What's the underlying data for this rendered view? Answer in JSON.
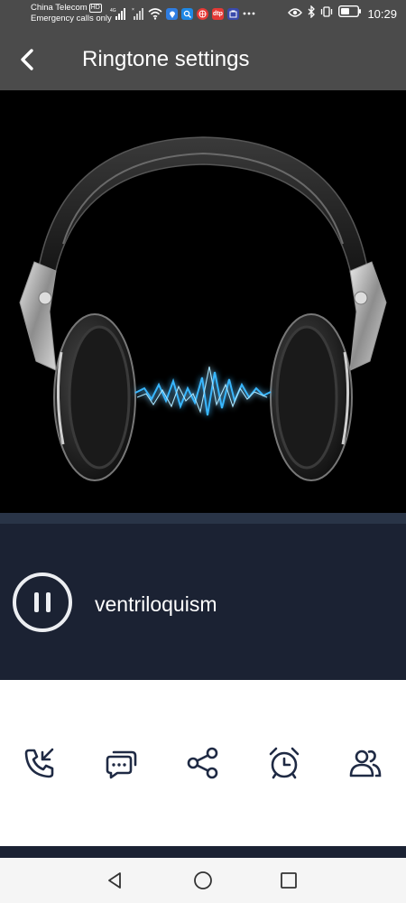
{
  "status_bar": {
    "carrier": "China Telecom",
    "hd_badge": "HD",
    "emergency": "Emergency calls only",
    "network_type": "4G",
    "time": "10:29",
    "app_badges": [
      {
        "icon": "location-pin-icon",
        "color": "#2f7de1"
      },
      {
        "icon": "search-app-icon",
        "color": "#1e88e5"
      },
      {
        "icon": "browser-app-icon",
        "color": "#e53935"
      },
      {
        "icon": "dtp-app-icon",
        "label": "dtp",
        "color": "#e53935"
      },
      {
        "icon": "store-app-icon",
        "color": "#3949ab"
      }
    ]
  },
  "header": {
    "title": "Ringtone settings",
    "back_icon": "chevron-left-icon"
  },
  "artwork": {
    "description_icon": "headphones-image",
    "glow_color": "#39b7ff"
  },
  "player": {
    "state": "playing",
    "control_icon": "pause-icon",
    "track_name": "ventriloquism"
  },
  "actions": [
    {
      "name": "set-call-ringtone",
      "icon": "phone-incoming-icon"
    },
    {
      "name": "set-message-tone",
      "icon": "message-icon"
    },
    {
      "name": "share",
      "icon": "share-icon"
    },
    {
      "name": "set-alarm",
      "icon": "alarm-clock-icon"
    },
    {
      "name": "set-contact-ringtone",
      "icon": "contacts-icon"
    }
  ],
  "nav": {
    "back_icon": "nav-back-icon",
    "home_icon": "nav-home-icon",
    "recents_icon": "nav-recents-icon"
  },
  "colors": {
    "header_bg": "#4b4b4b",
    "player_bg": "#1b2233",
    "accent_icon": "#1f2a44"
  }
}
